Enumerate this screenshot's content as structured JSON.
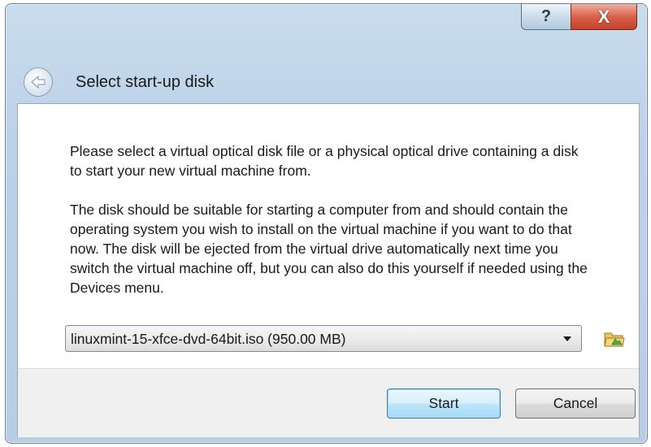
{
  "window": {
    "help_glyph": "?",
    "close_glyph": "X"
  },
  "header": {
    "title": "Select start-up disk",
    "back_icon": "back-arrow-icon"
  },
  "body": {
    "paragraph1": "Please select a virtual optical disk file or a physical optical drive containing a disk to start your new virtual machine from.",
    "paragraph2": "The disk should be suitable for starting a computer from and should contain the operating system you wish to install on the virtual machine if you want to do that now. The disk will be ejected from the virtual drive automatically next time you switch the virtual machine off, but you can also do this yourself if needed using the Devices menu."
  },
  "disk_select": {
    "selected": "linuxmint-15-xfce-dvd-64bit.iso (950.00 MB)",
    "browse_icon": "folder-icon"
  },
  "buttons": {
    "start": "Start",
    "cancel": "Cancel"
  },
  "colors": {
    "close_red": "#c4402a",
    "frame_blue": "#b6cde4",
    "default_button_border": "#3c7fb1"
  }
}
